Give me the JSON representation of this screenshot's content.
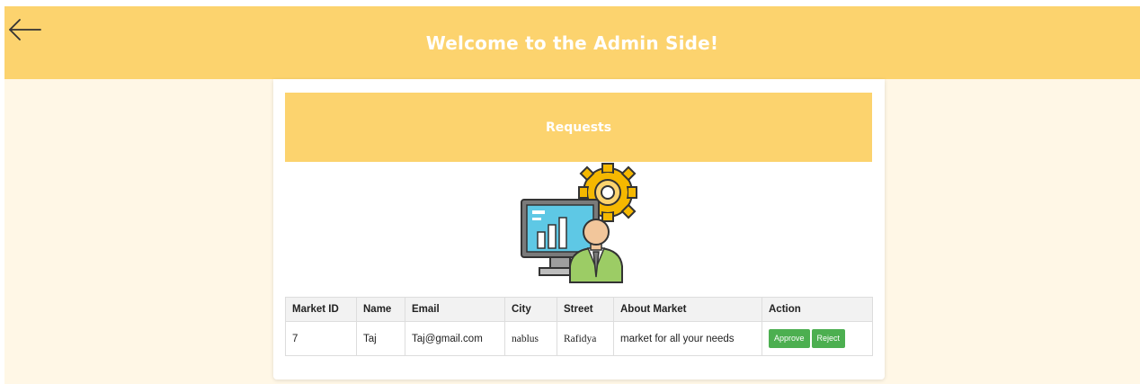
{
  "header": {
    "title": "Welcome to the Admin Side!",
    "back_icon": "arrow-left-icon",
    "color": "#fcd36e"
  },
  "section": {
    "title": "Requests",
    "illustration_icon": "admin-analytics-icon"
  },
  "table": {
    "columns": [
      "Market ID",
      "Name",
      "Email",
      "City",
      "Street",
      "About Market",
      "Action"
    ],
    "rows": [
      {
        "market_id": "7",
        "name": "Taj",
        "email": "Taj@gmail.com",
        "city": "nablus",
        "street": "Rafidya",
        "about": "market for all your needs",
        "approve_label": "Approve",
        "reject_label": "Reject"
      }
    ]
  },
  "colors": {
    "accent": "#fcd36e",
    "page_background": "#fff7e6",
    "button_green": "#4caf50"
  }
}
